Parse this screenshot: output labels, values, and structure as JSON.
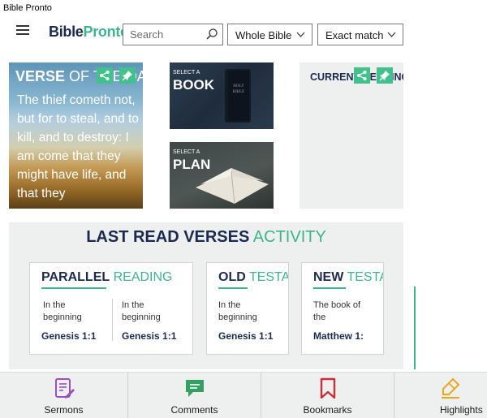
{
  "window": {
    "title": "Bible Pronto"
  },
  "header": {
    "logo_part1": "Bible",
    "logo_part2": "Pronto",
    "search_placeholder": "Search",
    "version_dropdown": "Whole Bible",
    "match_dropdown": "Exact match"
  },
  "tiles": {
    "verse": {
      "head_bold": "VERSE",
      "head_rest": "OF THE DAY",
      "text": "The thief cometh not, but for to steal, and to kill, and to destroy: I am come that they might have life, and that they"
    },
    "book": {
      "small": "SELECT A",
      "big": "BOOK"
    },
    "plan": {
      "small": "SELECT A",
      "big": "PLAN"
    },
    "current_reading": {
      "label": "CURRENT READING A"
    }
  },
  "activity": {
    "title_bold": "LAST READ VERSES",
    "title_accent": "ACTIVITY",
    "cards": [
      {
        "title_bold": "PARALLEL",
        "title_rest": "READING",
        "entries": [
          {
            "text": "In the beginning",
            "ref": "Genesis 1:1"
          },
          {
            "text": "In the beginning",
            "ref": "Genesis 1:1"
          }
        ]
      },
      {
        "title_bold": "OLD",
        "title_rest": "TESTAMENT",
        "entries": [
          {
            "text": "In the beginning",
            "ref": "Genesis 1:1"
          }
        ]
      },
      {
        "title_bold": "NEW",
        "title_rest": "TESTAMENT",
        "entries": [
          {
            "text": "The book of the",
            "ref": "Matthew 1:"
          }
        ]
      }
    ]
  },
  "bottom_nav": [
    {
      "label": "Sermons",
      "icon": "sermons-icon"
    },
    {
      "label": "Comments",
      "icon": "comments-icon"
    },
    {
      "label": "Bookmarks",
      "icon": "bookmark-icon"
    },
    {
      "label": "Highlights",
      "icon": "highlighter-icon"
    }
  ],
  "colors": {
    "accent": "#3db48a",
    "navy": "#1d2a4f",
    "panel_bg": "#eef0f0",
    "sermons": "#9b4fb8",
    "comments": "#35a063",
    "bookmarks": "#c9313a",
    "highlights": "#e8a81a"
  }
}
